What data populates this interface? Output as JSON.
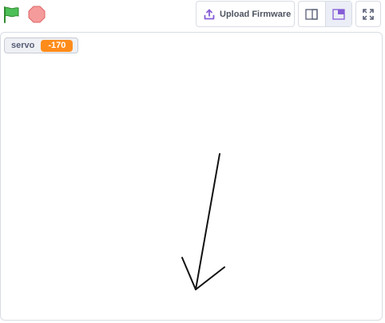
{
  "toolbar": {
    "green_flag_icon": "green-flag-icon",
    "stop_icon": "stop-icon",
    "upload_label": "Upload Firmware",
    "upload_icon": "upload-icon",
    "small_stage_icon": "small-stage-icon",
    "large_stage_icon": "large-stage-icon",
    "fullscreen_icon": "fullscreen-icon",
    "accent_color": "#855cd6"
  },
  "stage": {
    "monitor": {
      "label": "servo",
      "value": "-170",
      "value_color": "#ff8c1a"
    },
    "sprite": "arrow"
  }
}
